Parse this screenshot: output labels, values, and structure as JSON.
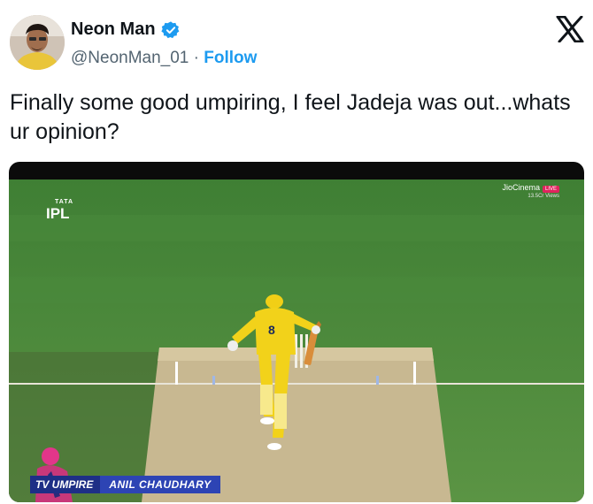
{
  "tweet": {
    "author": {
      "display_name": "Neon Man",
      "handle": "@NeonMan_01",
      "separator": "·",
      "follow_label": "Follow",
      "verified": true
    },
    "text": "Finally some good umpiring, I feel Jadeja was out...whats ur opinion?",
    "media": {
      "broadcaster": "JioCinema",
      "live_badge": "LIVE",
      "views": "13.5Cr Views",
      "league_logo": "IPL",
      "league_sponsor": "TATA",
      "player_number": "8",
      "caption_label": "TV UMPIRE",
      "caption_name": "ANIL CHAUDHARY"
    }
  },
  "icons": {
    "platform_logo": "x-logo-icon",
    "verified_badge": "verified-badge-icon"
  },
  "colors": {
    "link": "#1d9bf0",
    "verified": "#1d9bf0",
    "text_primary": "#0f1419",
    "text_secondary": "#536471",
    "pitch_green": "#4f8a3b",
    "jersey_yellow": "#f2d21a",
    "caption_blue": "#1e2f86"
  }
}
